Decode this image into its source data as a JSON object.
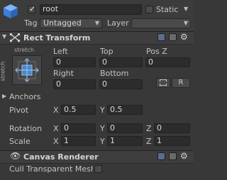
{
  "gameobject": {
    "name": "root",
    "static_label": "Static",
    "tag_label": "Tag",
    "tag_value": "Untagged",
    "layer_label": "Layer",
    "layer_value": ""
  },
  "rect_transform": {
    "title": "Rect Transform",
    "anchor_preset": {
      "top_label": "stretch",
      "side_label": "stretch"
    },
    "labels": {
      "left": "Left",
      "top": "Top",
      "posz": "Pos Z",
      "right": "Right",
      "bottom": "Bottom"
    },
    "values": {
      "left": "0",
      "top": "0",
      "posz": "0",
      "right": "0",
      "bottom": "0"
    },
    "r_button": "R",
    "anchors_label": "Anchors",
    "pivot_label": "Pivot",
    "pivot": {
      "x": "0.5",
      "y": "0.5"
    },
    "rotation_label": "Rotation",
    "rotation": {
      "x": "0",
      "y": "0",
      "z": "0"
    },
    "scale_label": "Scale",
    "scale": {
      "x": "1",
      "y": "1",
      "z": "1"
    },
    "axis": {
      "x": "X",
      "y": "Y",
      "z": "Z"
    }
  },
  "canvas_renderer": {
    "title": "Canvas Renderer",
    "cull_label": "Cull Transparent Mesh"
  }
}
